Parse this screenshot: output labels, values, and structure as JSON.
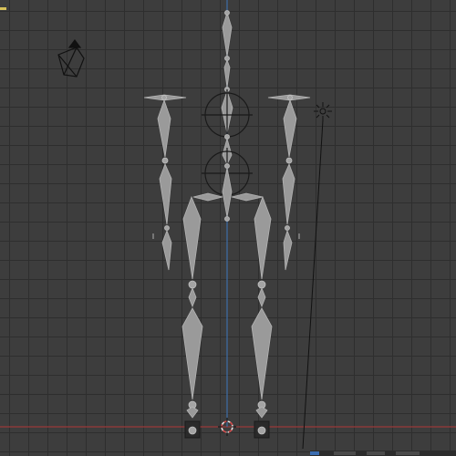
{
  "viewport": {
    "grid_color": "#2e2e2e",
    "background_color": "#3d3d3d",
    "x_axis_color": "#9a3a3a",
    "y_axis_color": "#3e6fa8",
    "bone_color": "#9a9a9a",
    "icons": [
      "camera-icon",
      "light-icon",
      "3d-cursor-icon",
      "armature-icon"
    ]
  }
}
